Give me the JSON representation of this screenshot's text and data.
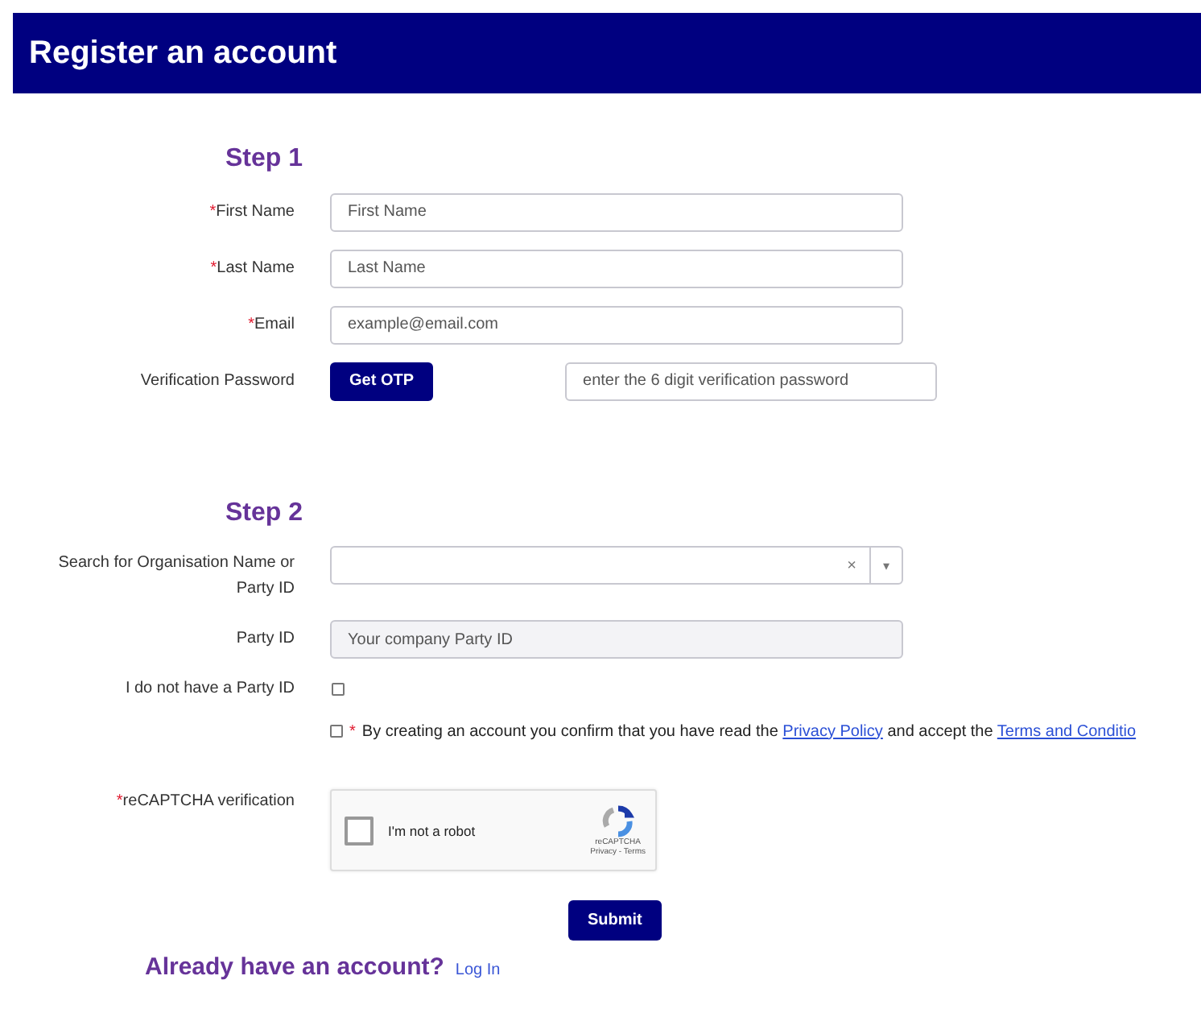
{
  "header": {
    "title": "Register an account"
  },
  "step1": {
    "heading": "Step 1",
    "fields": [
      {
        "label": "First Name",
        "mark": "*",
        "kind": "text",
        "placeholder": "First Name"
      },
      {
        "label": "Last Name",
        "mark": "*",
        "kind": "text",
        "placeholder": "Last Name"
      },
      {
        "label": "Email",
        "mark": "*",
        "kind": "text",
        "placeholder": "example@email.com"
      },
      {
        "label": "Verification Password",
        "kind": "otp",
        "button": "Get OTP",
        "placeholder": "enter the 6 digit verification password"
      }
    ]
  },
  "step2": {
    "heading": "Step 2",
    "fields": [
      {
        "label": "Search for Organisation Name or Party ID",
        "kind": "select",
        "clear": "×",
        "caret": "▾"
      },
      {
        "label": "Party ID",
        "kind": "readonly",
        "placeholder": "Your company Party ID"
      },
      {
        "label": "I do not have a Party ID",
        "kind": "checkbox",
        "checked": false
      }
    ]
  },
  "consent": {
    "checked": false,
    "mark": "*",
    "before": "By creating an account you confirm that you have read the ",
    "link1": "Privacy Policy",
    "middle": " and accept the ",
    "link2": "Terms and Conditio"
  },
  "captcha": {
    "label": "reCAPTCHA verification",
    "mark": "*",
    "checked": false,
    "text": "I'm not a robot",
    "brand": "reCAPTCHA",
    "privacy": "Privacy",
    "sep": " - ",
    "terms": "Terms"
  },
  "submit": "Submit",
  "footer": {
    "question": "Already have an account?",
    "link": "Log In"
  }
}
